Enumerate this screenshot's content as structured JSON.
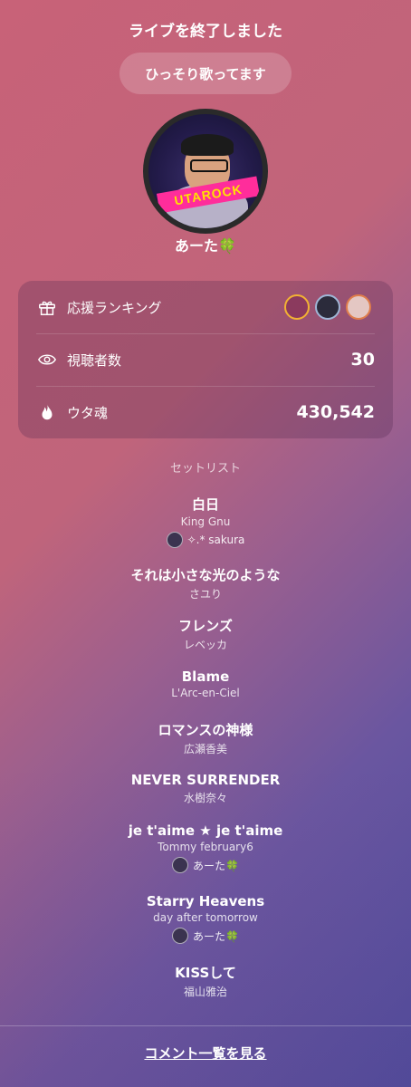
{
  "header": {
    "title": "ライブを終了しました"
  },
  "live": {
    "title": "ひっそり歌ってます"
  },
  "host": {
    "name": "あーた🍀",
    "logo_text": "UTAROCK"
  },
  "stats": {
    "ranking_label": "応援ランキング",
    "viewers_label": "視聴者数",
    "viewers_value": "30",
    "soul_label": "ウタ魂",
    "soul_value": "430,542"
  },
  "setlist": {
    "title": "セットリスト",
    "songs": [
      {
        "name": "白日",
        "artist": "King Gnu",
        "requester": "✧.* sakura"
      },
      {
        "name": "それは小さな光のような",
        "artist": "さユり"
      },
      {
        "name": "フレンズ",
        "artist": "レベッカ"
      },
      {
        "name": "Blame",
        "artist": "L'Arc-en-Ciel"
      },
      {
        "name": "ロマンスの神様",
        "artist": "広瀬香美"
      },
      {
        "name": "NEVER SURRENDER",
        "artist": "水樹奈々"
      },
      {
        "name": "je t'aime ★ je t'aime",
        "artist": "Tommy february6",
        "requester": "あーた🍀"
      },
      {
        "name": "Starry Heavens",
        "artist": "day after tomorrow",
        "requester": "あーた🍀"
      },
      {
        "name": "KISSして",
        "artist": "福山雅治"
      }
    ]
  },
  "footer": {
    "comments_link": "コメント一覧を見る"
  },
  "colors": {
    "rank_ring": "#f2b233",
    "clover": "#3ec44a"
  },
  "icons": {
    "ranking": "gift-icon",
    "viewers": "eye-icon",
    "soul": "flame-icon"
  }
}
